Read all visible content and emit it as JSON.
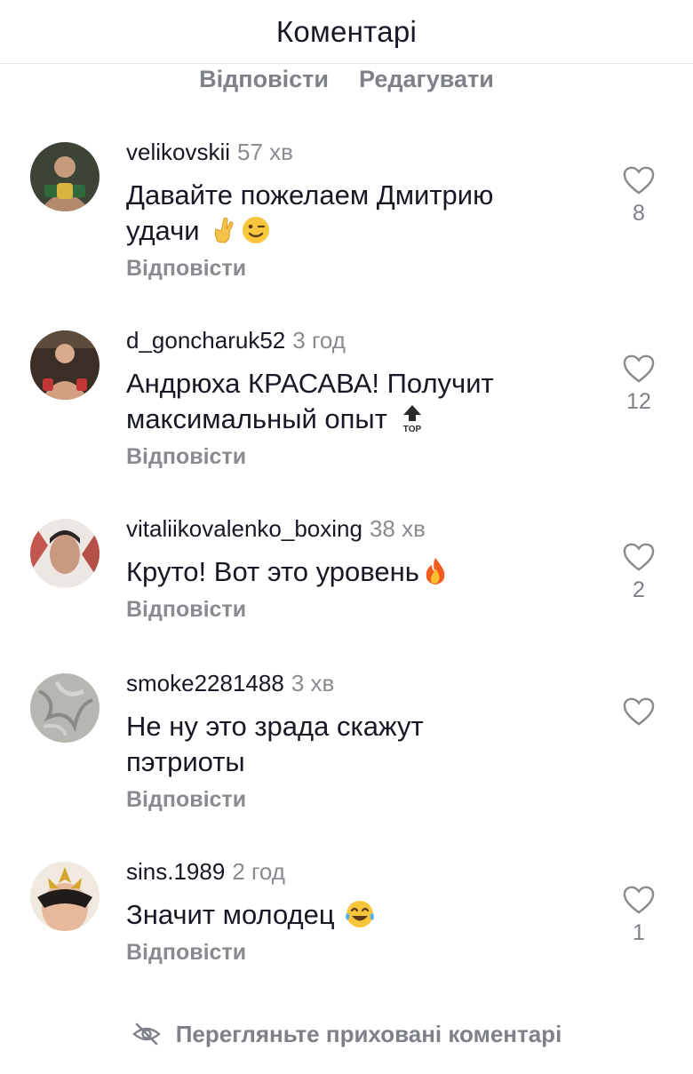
{
  "header": {
    "title": "Коментарі"
  },
  "top_actions": {
    "reply": "Відповісти",
    "edit": "Редагувати"
  },
  "comments": [
    {
      "user": "velikovskii",
      "time": "57 хв",
      "line1": "Давайте пожелаем Дмитрию",
      "line2": "удачи",
      "emoji": "crossed-fingers-and-wink",
      "reply": "Відповісти",
      "likes": "8"
    },
    {
      "user": "d_goncharuk52",
      "time": "3 год",
      "line1": "Андрюха КРАСАВА! Получит",
      "line2": "максимальный опыт",
      "emoji": "top-arrow",
      "reply": "Відповісти",
      "likes": "12"
    },
    {
      "user": "vitaliikovalenko_boxing",
      "time": "38 хв",
      "line1": "Круто! Вот это уровень",
      "line2": "",
      "emoji": "fire",
      "reply": "Відповісти",
      "likes": "2"
    },
    {
      "user": "smoke2281488",
      "time": "3 хв",
      "line1": "Не ну это зрада скажут",
      "line2": "пэтриоты",
      "emoji": "",
      "reply": "Відповісти",
      "likes": ""
    },
    {
      "user": "sins.1989",
      "time": "2 год",
      "line1": "Значит молодец",
      "line2": "",
      "emoji": "tears-of-joy",
      "reply": "Відповісти",
      "likes": "1"
    }
  ],
  "footer": {
    "hidden_comments": "Перегляньте приховані коментарі",
    "icon": "eye-off-icon"
  }
}
